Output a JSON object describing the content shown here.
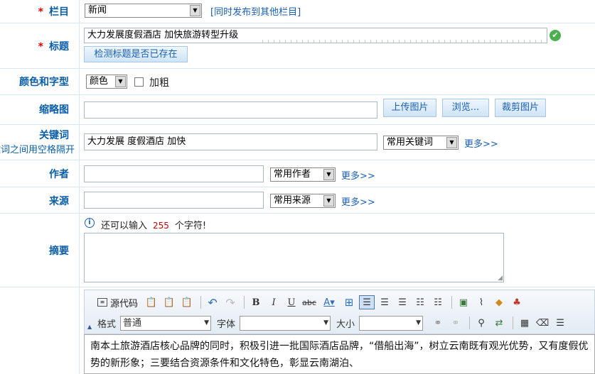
{
  "column": {
    "label": "栏目",
    "required": "*",
    "value": "新闻",
    "sync_link": "[同时发布到其他栏目]"
  },
  "title": {
    "label": "标题",
    "required": "*",
    "value": "大力发展度假酒店 加快旅游转型升级",
    "check_button": "检测标题是否已存在"
  },
  "color_font": {
    "label": "颜色和字型",
    "color_select": "颜色",
    "bold_label": "加粗"
  },
  "thumbnail": {
    "label": "缩略图",
    "value": "",
    "upload_button": "上传图片",
    "browse_button": "浏览...",
    "crop_button": "裁剪图片"
  },
  "keywords": {
    "label": "关键词",
    "hint": "多个关键词之间用空格隔开",
    "value": "大力发展 度假酒店 加快",
    "common_select": "常用关键词",
    "more_link": "更多>>"
  },
  "author": {
    "label": "作者",
    "value": "",
    "common_select": "常用作者",
    "more_link": "更多>>"
  },
  "source": {
    "label": "来源",
    "value": "",
    "common_select": "常用来源",
    "more_link": "更多>>"
  },
  "summary": {
    "label": "摘要",
    "info_prefix": "还可以输入",
    "remaining": "255",
    "info_suffix": "个字符!"
  },
  "editor": {
    "source_label": "源代码",
    "format_label": "格式",
    "format_value": "普通",
    "font_label": "字体",
    "font_value": "",
    "size_label": "大小",
    "size_value": "",
    "content": "南本土旅游酒店核心品牌的同时，积极引进一批国际酒店品牌，“借船出海”，树立云南既有观光优势，又有度假优势的新形象；三要结合资源条件和文化特色，彰显云南湖泊、"
  },
  "colors": {
    "label": "#0a5ea8",
    "required": "#e10000",
    "border": "#d7e6f2",
    "link": "#1a5fb4"
  }
}
